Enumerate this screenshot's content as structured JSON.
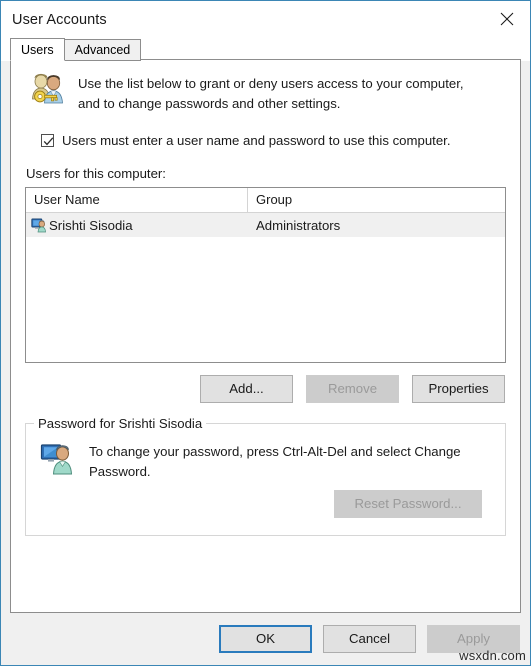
{
  "window": {
    "title": "User Accounts",
    "close_icon": "close-icon",
    "border_color": "#3b86b5"
  },
  "tabs": [
    {
      "label": "Users",
      "active": true
    },
    {
      "label": "Advanced",
      "active": false
    }
  ],
  "header": {
    "icon": "users-key-icon",
    "text": "Use the list below to grant or deny users access to your computer, and to change passwords and other settings."
  },
  "require_login_checkbox": {
    "label": "Users must enter a user name and password to use this computer.",
    "checked": true
  },
  "users_list": {
    "caption": "Users for this computer:",
    "columns": [
      "User Name",
      "Group"
    ],
    "rows": [
      {
        "icon": "user-monitor-small-icon",
        "user_name": "Srishti Sisodia",
        "group": "Administrators",
        "selected": true
      }
    ]
  },
  "list_buttons": {
    "add": {
      "label": "Add...",
      "enabled": true
    },
    "remove": {
      "label": "Remove",
      "enabled": false
    },
    "properties": {
      "label": "Properties",
      "enabled": true
    }
  },
  "password_group": {
    "title": "Password for Srishti Sisodia",
    "icon": "user-monitor-icon",
    "text": "To change your password, press Ctrl-Alt-Del and select Change Password.",
    "reset_button": {
      "label": "Reset Password...",
      "enabled": false
    }
  },
  "footer": {
    "ok": {
      "label": "OK",
      "enabled": true,
      "default": true
    },
    "cancel": {
      "label": "Cancel",
      "enabled": true
    },
    "apply": {
      "label": "Apply",
      "enabled": false
    },
    "watermark": "wsxdn.com"
  },
  "colors": {
    "accent": "#0078d7",
    "button_face": "#e1e1e1",
    "disabled_text": "#9a9a9a",
    "selection": "#f0f0f0"
  }
}
